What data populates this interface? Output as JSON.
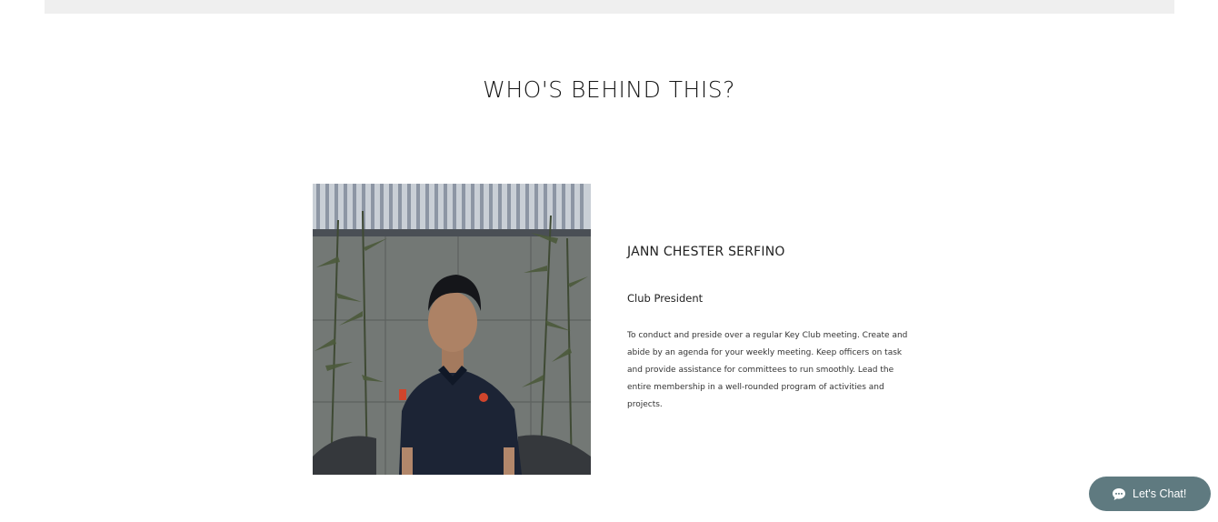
{
  "section": {
    "title": "WHO'S BEHIND THIS?"
  },
  "member": {
    "name": "JANN CHESTER SERFINO",
    "role": "Club President",
    "bio": "To conduct and preside over a regular Key Club meeting. Create and abide by an agenda for your weekly meeting. Keep officers on task and provide assistance for committees to run smoothly. Lead the entire membership in a well-rounded program of activities and projects.",
    "photo_icon": "member-portrait"
  },
  "chat": {
    "label": "Let's Chat!",
    "icon": "chat-bubble-icon",
    "color": "#5f7a80"
  }
}
